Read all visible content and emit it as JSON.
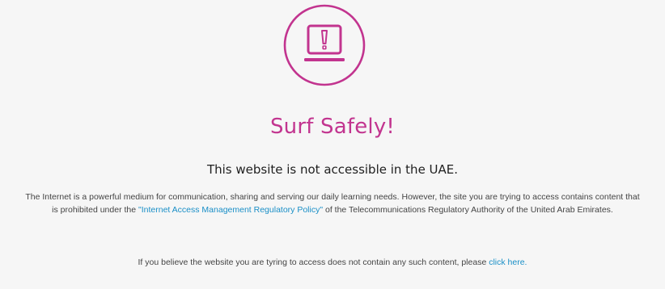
{
  "icon": {
    "name": "warning-laptop-icon",
    "color": "#c2348f"
  },
  "headline": "Surf Safely!",
  "subhead": "This website is not accessible in the UAE.",
  "body": {
    "text_before": "The Internet is a powerful medium for communication, sharing and serving our daily learning needs. However, the site you are trying to access contains content that is prohibited under the ",
    "policy_link": "\"Internet Access Management Regulatory Policy\"",
    "text_after": " of the Telecommunications Regulatory Authority of the United Arab Emirates."
  },
  "notice": {
    "text": "If you believe the website you are tyring to access does not contain any such content, please ",
    "link": "click here."
  },
  "colors": {
    "accent": "#c2348f",
    "link": "#1a8fc7",
    "background": "#f6f6f6"
  }
}
